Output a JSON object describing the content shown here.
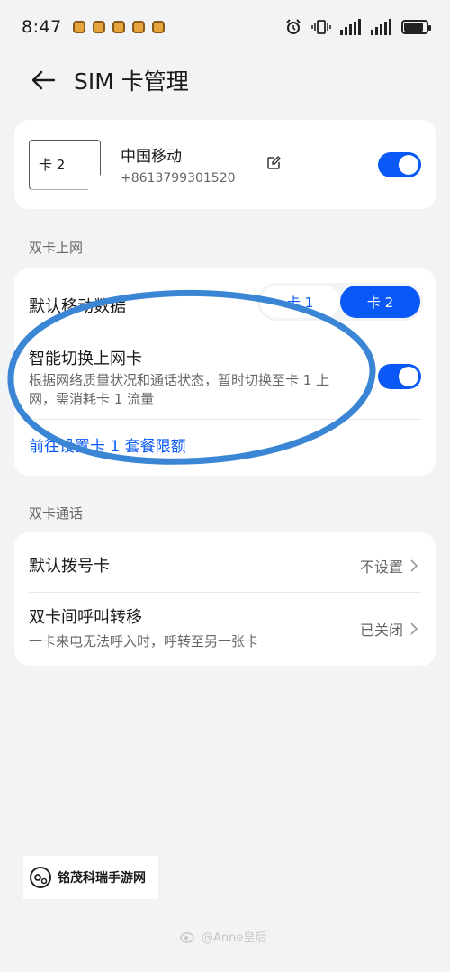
{
  "status_bar": {
    "time": "8:47",
    "notification_icons": [
      "app-notification-icon",
      "app-notification-icon",
      "app-notification-icon",
      "app-notification-icon",
      "app-notification-icon"
    ],
    "battery_percent": 90
  },
  "header": {
    "title": "SIM 卡管理"
  },
  "sim": {
    "slot_label": "卡 2",
    "carrier": "中国移动",
    "number": "+8613799301520",
    "enabled": true
  },
  "dual_data": {
    "section_label": "双卡上网",
    "default_data_label": "默认移动数据",
    "options": [
      "卡 1",
      "卡 2"
    ],
    "selected": "卡 2",
    "smart_switch_title": "智能切换上网卡",
    "smart_switch_desc": "根据网络质量状况和通话状态，暂时切换至卡 1 上网，需消耗卡 1 流量",
    "smart_switch_enabled": true,
    "plan_link": "前往设置卡 1 套餐限额"
  },
  "dual_call": {
    "section_label": "双卡通话",
    "default_dial_label": "默认拨号卡",
    "default_dial_value": "不设置",
    "forward_title": "双卡间呼叫转移",
    "forward_desc": "一卡来电无法呼入时，呼转至另一张卡",
    "forward_value": "已关闭"
  },
  "watermark": {
    "text": "铭茂科瑞手游网"
  },
  "weibo": {
    "text": "@Anne皇后"
  },
  "colors": {
    "accent": "#0a59f7",
    "highlight": "#3a86d4"
  }
}
